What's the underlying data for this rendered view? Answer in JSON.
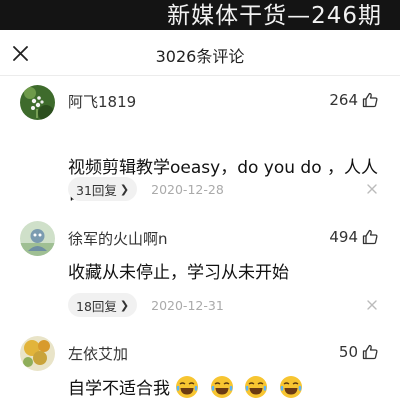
{
  "banner": {
    "title": "新媒体干货—246期"
  },
  "header": {
    "title": "3026条评论"
  },
  "comments": [
    {
      "user": "阿飞1819",
      "likes": "264",
      "text": "视频剪辑教学oeasy，do you do ，人人自学网",
      "replies": "31回复",
      "date": "2020-12-28"
    },
    {
      "user": "徐军的火山啊n",
      "likes": "494",
      "text": "收藏从未停止，学习从未开始",
      "replies": "18回复",
      "date": "2020-12-31"
    },
    {
      "user": "左依艾加",
      "likes": "50",
      "text": "自学不适合我",
      "emojis": [
        "laughing-crying-emoji",
        "laughing-crying-emoji",
        "laughing-crying-emoji",
        "laughing-crying-emoji"
      ]
    }
  ],
  "icons": {
    "close": "close-icon",
    "like": "thumbs-up-icon",
    "dismiss": "dismiss-icon",
    "chevron": "chevron-right-icon"
  },
  "colors": {
    "banner_bg": "#141414",
    "date_gray": "#aaaaaa",
    "pill_bg": "#f1f1f1"
  }
}
